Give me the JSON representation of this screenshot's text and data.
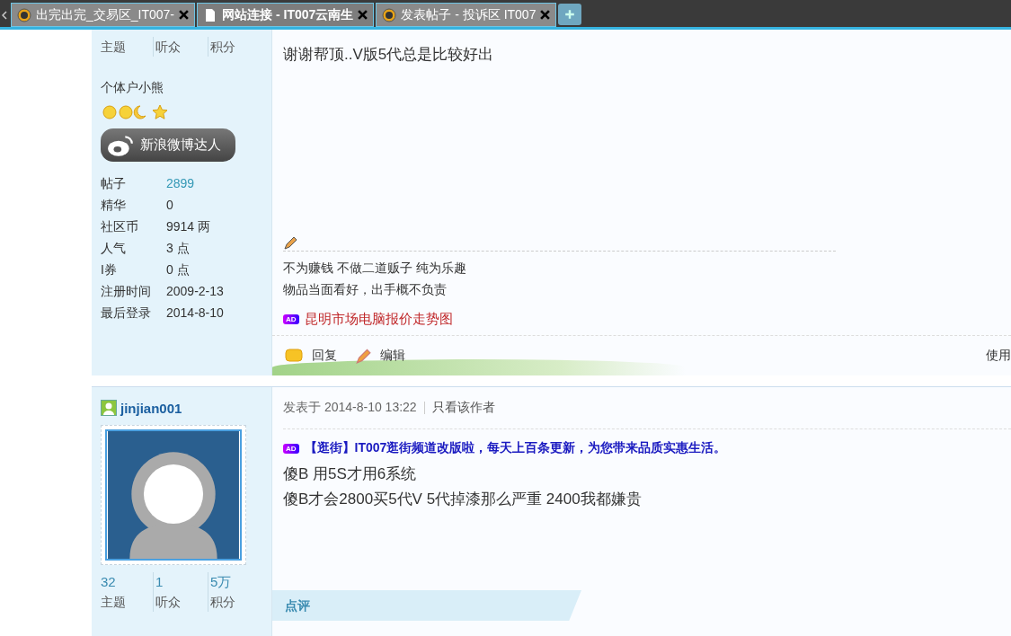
{
  "tabs": [
    {
      "label": "出完出完_交易区_IT007-",
      "kind": "site",
      "selected": false
    },
    {
      "label": "网站连接 - IT007云南生",
      "kind": "page",
      "selected": true
    },
    {
      "label": "发表帖子 - 投诉区 IT007",
      "kind": "site",
      "selected": false
    }
  ],
  "posts": [
    {
      "stats": [
        {
          "label": "主题"
        },
        {
          "label": "听众"
        },
        {
          "label": "积分"
        }
      ],
      "group": "个体户小熊",
      "badge": "新浪微博达人",
      "profile": [
        {
          "label": "帖子",
          "value": "2899",
          "link": true
        },
        {
          "label": "精华",
          "value": "0",
          "link": false
        },
        {
          "label": "社区币",
          "value": "9914 两",
          "link": false
        },
        {
          "label": "人气",
          "value": "3 点",
          "link": false
        },
        {
          "label": "I券",
          "value": "0 点",
          "link": false
        },
        {
          "label": "注册时间",
          "value": "2009-2-13",
          "link": false
        },
        {
          "label": "最后登录",
          "value": "2014-8-10",
          "link": false
        }
      ],
      "body": [
        "谢谢帮顶..V版5代总是比较好出"
      ],
      "signature": [
        "不为赚钱 不做二道贩子 纯为乐趣",
        "物品当面看好，出手概不负责"
      ],
      "ad": {
        "badge": "AD",
        "text": "昆明市场电脑报价走势图"
      },
      "actions": [
        "回复",
        "编辑"
      ],
      "right_text": "使用"
    },
    {
      "username": "jinjian001",
      "stats": [
        {
          "value": "32",
          "label": "主题"
        },
        {
          "value": "1",
          "label": "听众"
        },
        {
          "value": "5万",
          "label": "积分"
        }
      ],
      "posted": "发表于 2014-8-10 13:22",
      "author_only": "只看该作者",
      "ad": {
        "badge": "AD",
        "text": "【逛街】IT007逛街频道改版啦，每天上百条更新，为您带来品质实惠生活。"
      },
      "body": [
        "傻B 用5S才用6系统",
        "傻B才会2800买5代V  5代掉漆那么严重 2400我都嫌贵"
      ],
      "comment_header": "点评"
    }
  ]
}
